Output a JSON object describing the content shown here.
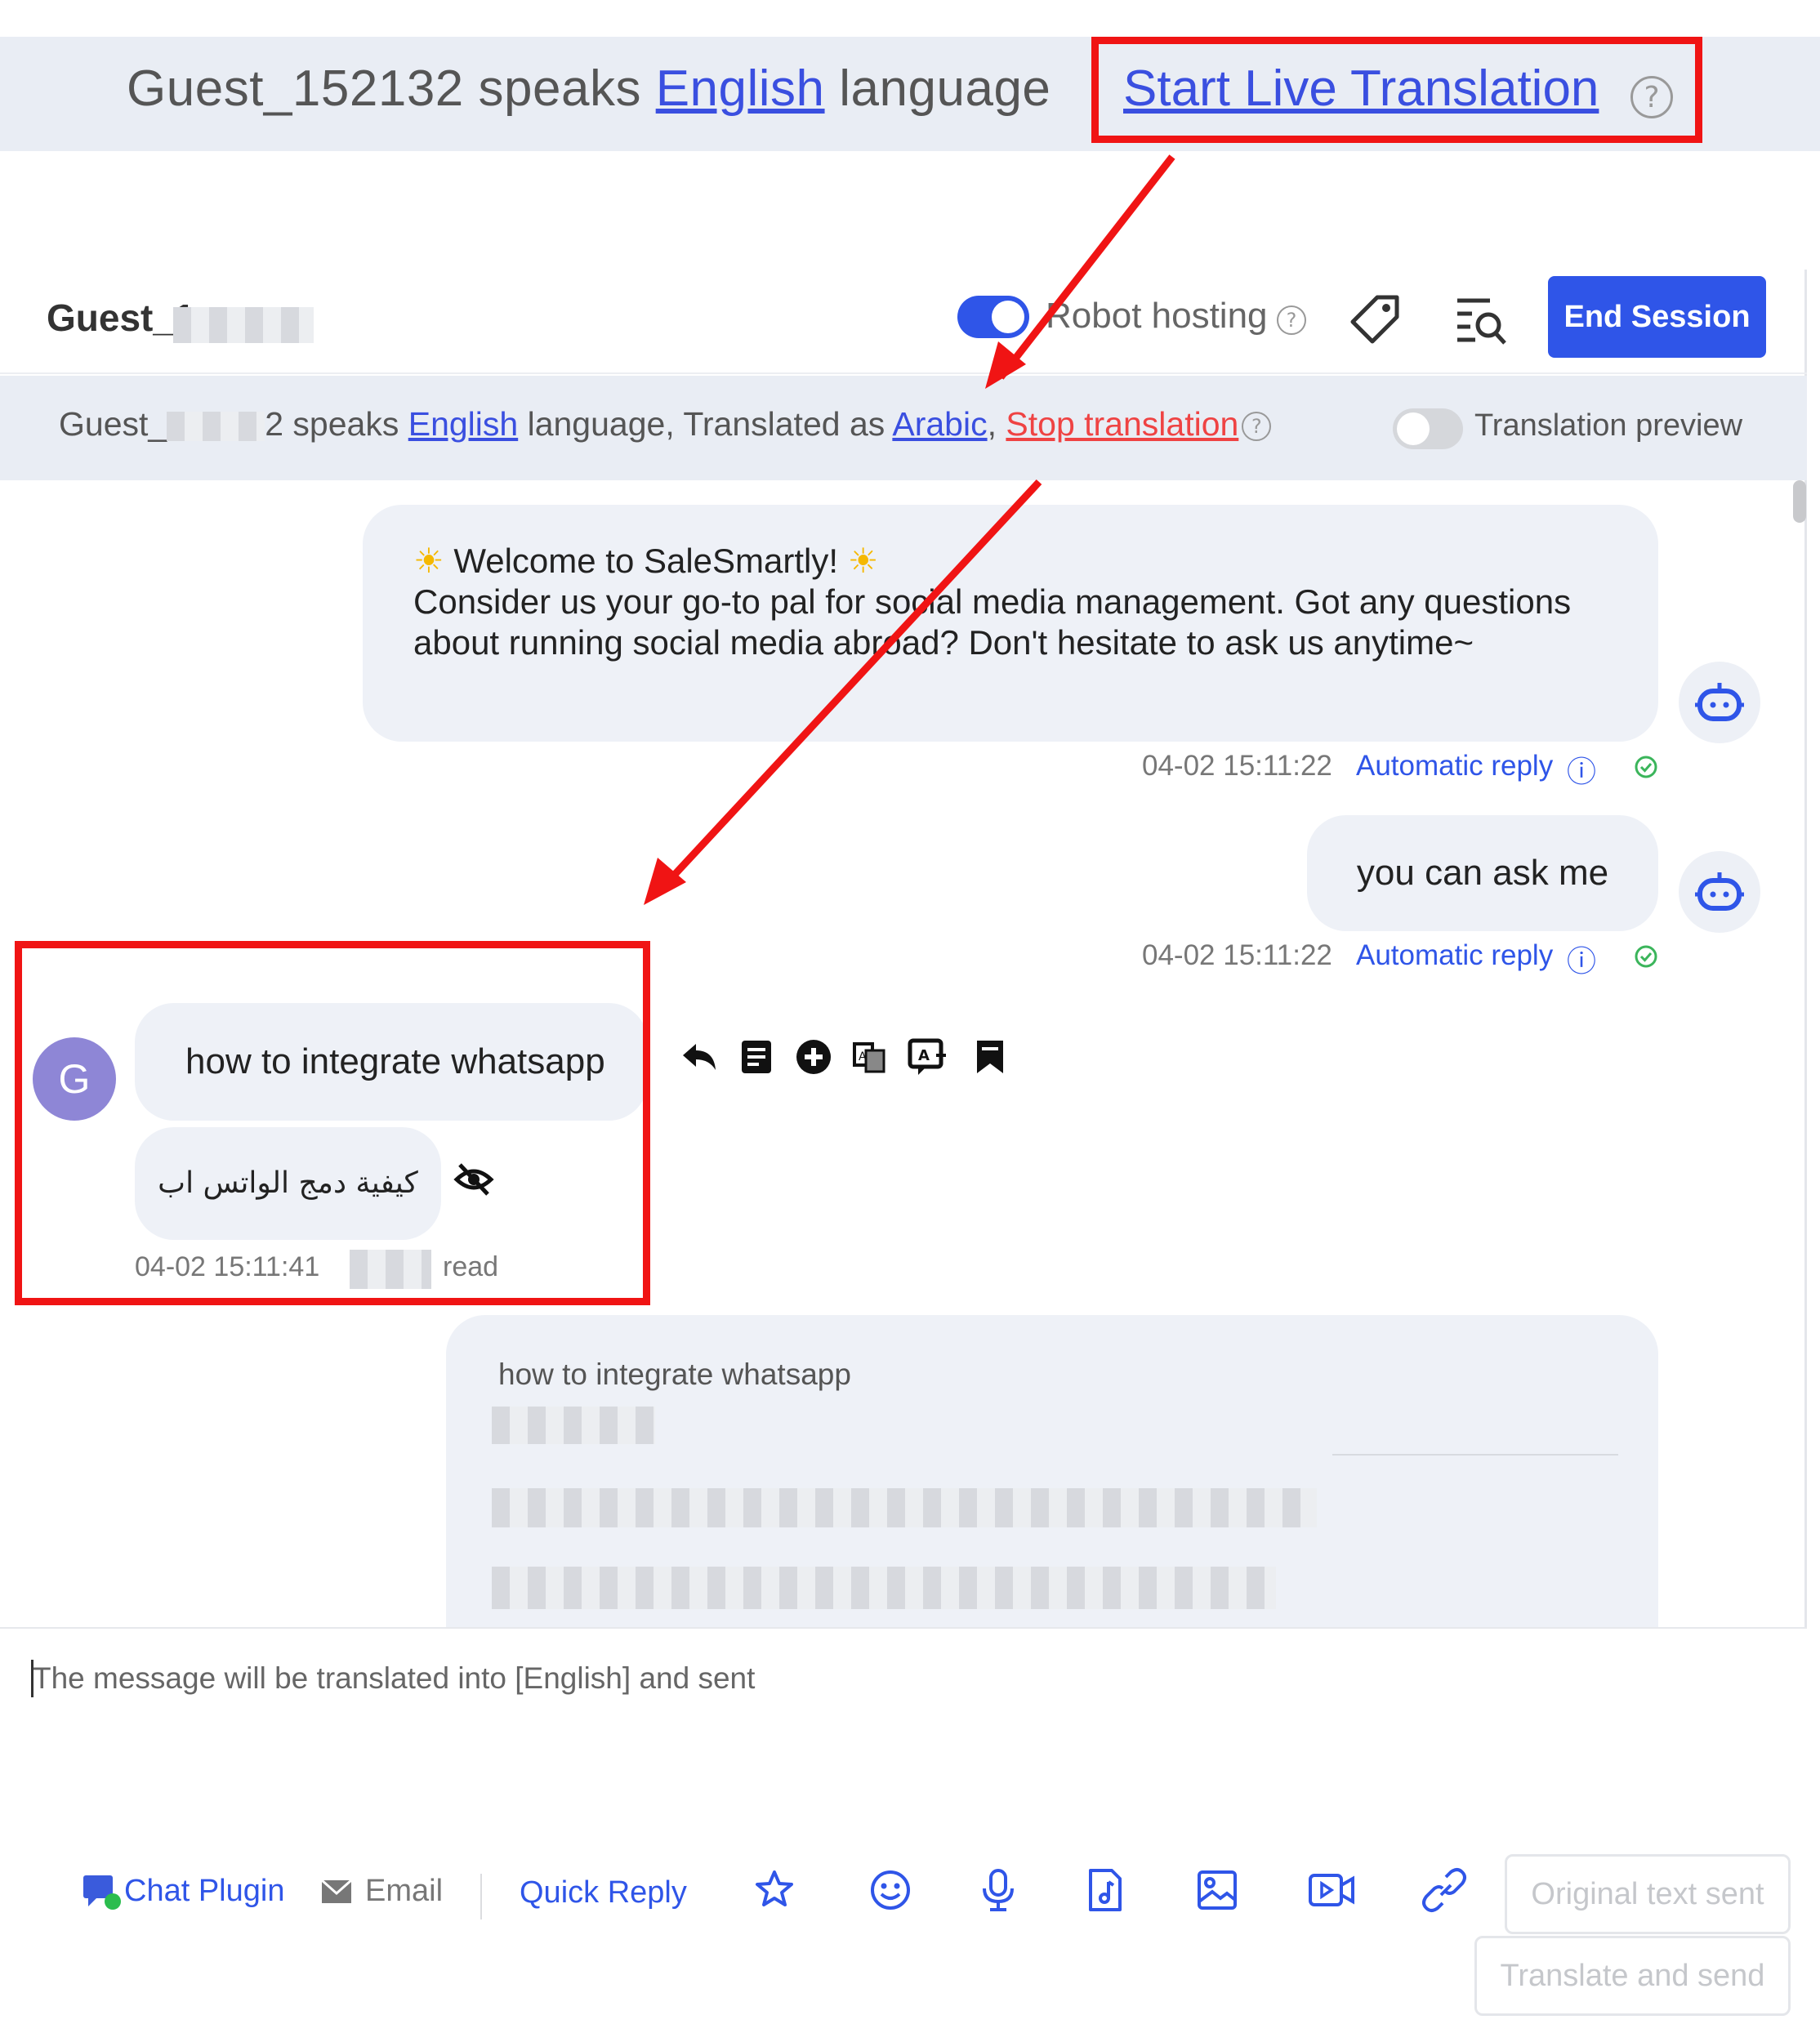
{
  "top_banner": {
    "prefix": "Guest_152132 speaks ",
    "language_link": "English",
    "suffix": " language",
    "start_live_translation": "Start Live Translation",
    "help": "?"
  },
  "header": {
    "guest_name": "Guest_1",
    "robot_hosting_label": "Robot hosting",
    "robot_hosting_on": true,
    "help": "?",
    "end_session_label": "End Session"
  },
  "translation_bar": {
    "guest_prefix": "Guest_",
    "guest_tail": "2",
    "speaks": " speaks ",
    "language_link": "English",
    "mid": " language, Translated as ",
    "target_link": "Arabic",
    "comma": ",",
    "stop_link": "Stop translation",
    "help": "?",
    "preview_label": "Translation preview",
    "preview_on": false
  },
  "messages": {
    "welcome": {
      "line1": "Welcome to SaleSmartly!",
      "body": "Consider us your go-to pal for social media management. Got any questions about running social media abroad? Don't hesitate to ask us anytime~",
      "timestamp": "04-02 15:11:22",
      "tag": "Automatic reply",
      "info": "ⓘ"
    },
    "ask": {
      "text": "you can ask me",
      "timestamp": "04-02 15:11:22",
      "tag": "Automatic reply",
      "info": "ⓘ"
    },
    "guest": {
      "avatar_letter": "G",
      "text": "how to integrate whatsapp",
      "translation": "كيفية دمج الواتس اب",
      "timestamp": "04-02 15:11:41",
      "status": "read"
    },
    "card": {
      "title": "how to integrate whatsapp"
    }
  },
  "composer": {
    "placeholder": "The message will be translated into [English] and sent",
    "chat_plugin": "Chat Plugin",
    "email": "Email",
    "quick_reply": "Quick Reply",
    "original_text_sent": "Original text sent",
    "translate_and_send": "Translate and send"
  },
  "colors": {
    "accent": "#2f55e8",
    "banner_bg": "#e9edf4",
    "annotation_red": "#f01414",
    "stop_link": "#ef4343",
    "avatar": "#8e86d6"
  }
}
